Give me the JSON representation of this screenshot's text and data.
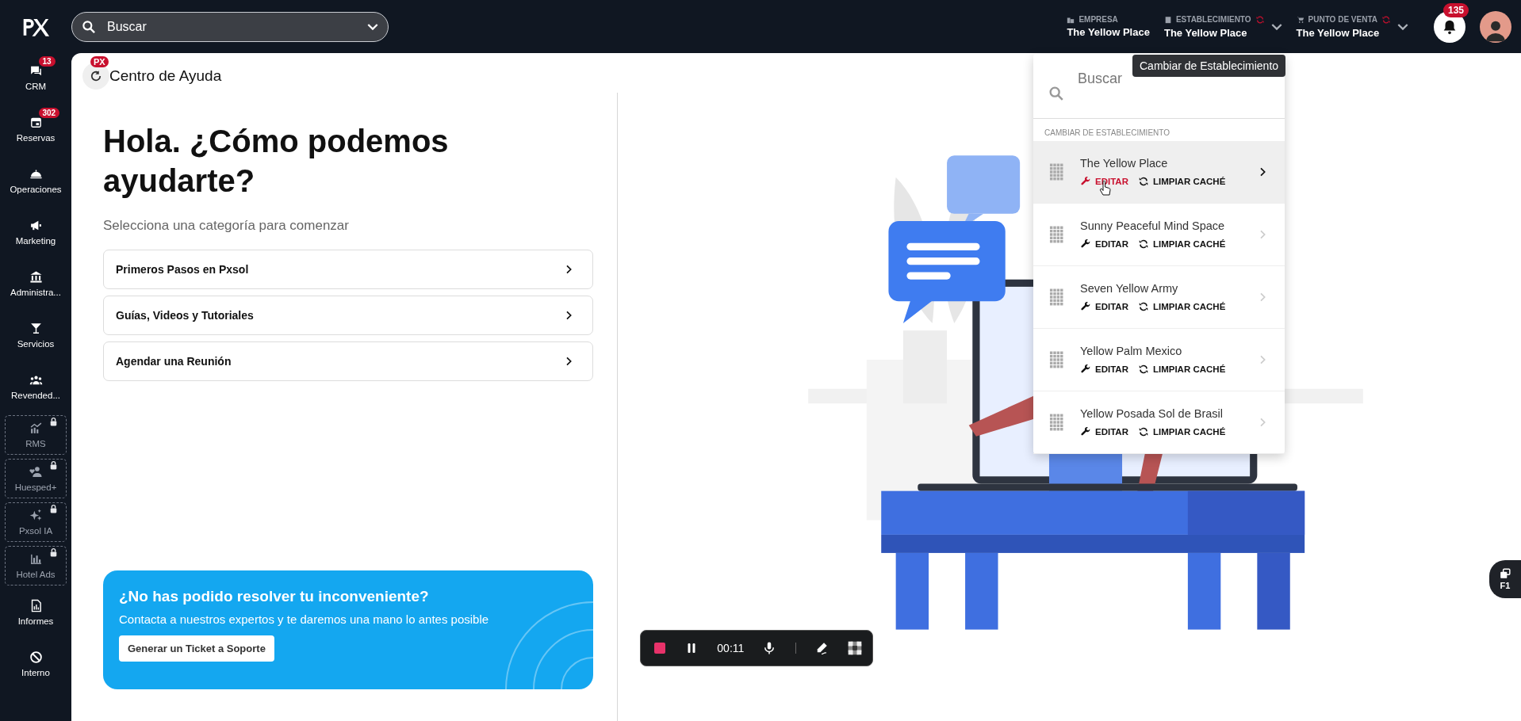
{
  "topbar": {
    "search": {
      "placeholder": "Buscar"
    },
    "contexts": [
      {
        "label": "EMPRESA",
        "value": "The Yellow Place",
        "kind": "company",
        "sync": false,
        "dropdown": false
      },
      {
        "label": "ESTABLECIMIENTO",
        "value": "The Yellow Place",
        "kind": "property",
        "sync": true,
        "dropdown": true
      },
      {
        "label": "PUNTO DE VENTA",
        "value": "The Yellow Place",
        "kind": "store",
        "sync": true,
        "dropdown": true
      }
    ],
    "notifications": {
      "count": "135"
    }
  },
  "sidebar": {
    "items": [
      {
        "label": "CRM",
        "badge": "13",
        "locked": false
      },
      {
        "label": "Reservas",
        "badge": "302",
        "locked": false
      },
      {
        "label": "Operaciones",
        "locked": false
      },
      {
        "label": "Marketing",
        "locked": false
      },
      {
        "label": "Administra...",
        "locked": false
      },
      {
        "label": "Servicios",
        "locked": false
      },
      {
        "label": "Revended...",
        "locked": false
      },
      {
        "label": "RMS",
        "locked": true
      },
      {
        "label": "Huesped+",
        "locked": true
      },
      {
        "label": "Pxsol IA",
        "locked": true
      },
      {
        "label": "Hotel Ads",
        "locked": true
      },
      {
        "label": "Informes",
        "locked": false
      },
      {
        "label": "Interno",
        "locked": false
      }
    ]
  },
  "page": {
    "title": "Centro de Ayuda",
    "badge": "PX",
    "heading": "Hola. ¿Cómo podemos ayudarte?",
    "subheading": "Selecciona una categoría para comenzar",
    "categories": [
      "Primeros Pasos en Pxsol",
      "Guías, Videos y Tutoriales",
      "Agendar una Reunión"
    ],
    "support": {
      "title": "¿No has podido resolver tu inconveniente?",
      "text": "Contacta a nuestros expertos y te daremos una mano lo antes posible",
      "button": "Generar un Ticket a Soporte"
    }
  },
  "tooltip": "Cambiar de Establecimiento",
  "dropdown": {
    "search": {
      "placeholder": "Buscar"
    },
    "section_label": "CAMBIAR DE ESTABLECIMIENTO",
    "items": [
      {
        "name": "The Yellow Place",
        "edit": "EDITAR",
        "clear": "LIMPIAR CACHÉ",
        "selected": true,
        "edit_hovered": true
      },
      {
        "name": "Sunny Peaceful Mind Space",
        "edit": "EDITAR",
        "clear": "LIMPIAR CACHÉ",
        "selected": false,
        "edit_hovered": false
      },
      {
        "name": "Seven Yellow Army",
        "edit": "EDITAR",
        "clear": "LIMPIAR CACHÉ",
        "selected": false,
        "edit_hovered": false
      },
      {
        "name": "Yellow Palm Mexico",
        "edit": "EDITAR",
        "clear": "LIMPIAR CACHÉ",
        "selected": false,
        "edit_hovered": false
      },
      {
        "name": "Yellow Posada Sol de Brasil",
        "edit": "EDITAR",
        "clear": "LIMPIAR CACHÉ",
        "selected": false,
        "edit_hovered": false
      }
    ]
  },
  "recorder": {
    "time": "00:11"
  },
  "help_button": {
    "label": "F1"
  }
}
